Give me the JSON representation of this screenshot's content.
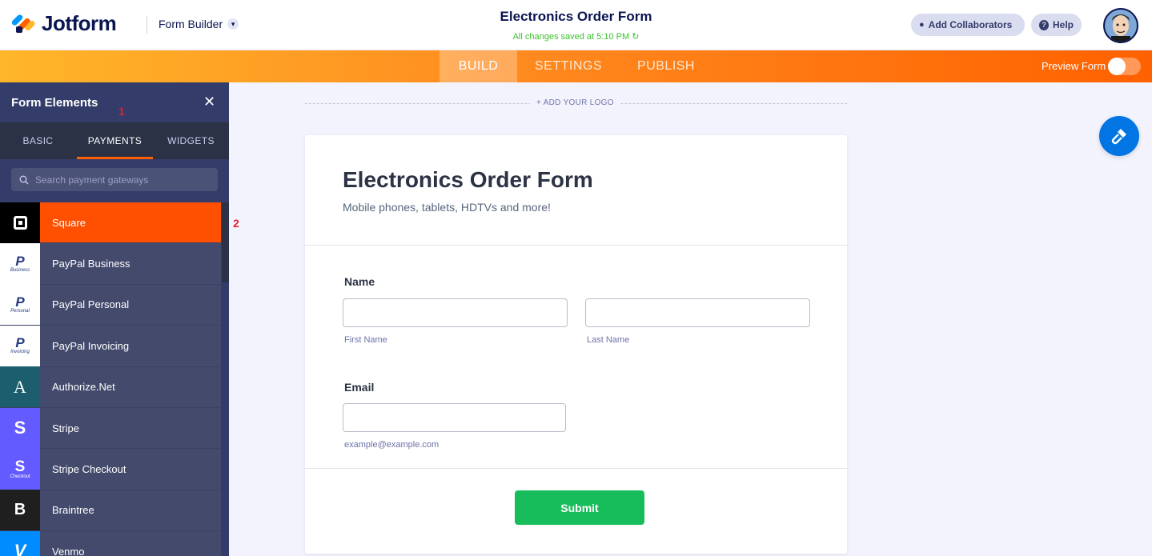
{
  "header": {
    "brand": "Jotform",
    "builder_label": "Form Builder",
    "form_title": "Electronics Order Form",
    "saved_status": "All changes saved at 5:10 PM",
    "add_collaborators_label": "Add Collaborators",
    "help_label": "Help"
  },
  "nav": {
    "tabs": [
      {
        "label": "BUILD",
        "active": true
      },
      {
        "label": "SETTINGS",
        "active": false
      },
      {
        "label": "PUBLISH",
        "active": false
      }
    ],
    "preview_label": "Preview Form",
    "preview_on": false
  },
  "sidebar": {
    "title": "Form Elements",
    "tabs": [
      {
        "label": "BASIC",
        "active": false
      },
      {
        "label": "PAYMENTS",
        "active": true
      },
      {
        "label": "WIDGETS",
        "active": false
      }
    ],
    "search_placeholder": "Search payment gateways",
    "items": [
      {
        "label": "Square",
        "icon": "square-icon",
        "icon_bg": "#000000",
        "active": true
      },
      {
        "label": "PayPal Business",
        "icon": "paypal-icon",
        "icon_caption": "Business",
        "icon_bg": "#ffffff"
      },
      {
        "label": "PayPal Personal",
        "icon": "paypal-icon",
        "icon_caption": "Personal",
        "icon_bg": "#ffffff"
      },
      {
        "label": "PayPal Invoicing",
        "icon": "paypal-icon",
        "icon_caption": "Invoicing",
        "icon_bg": "#ffffff"
      },
      {
        "label": "Authorize.Net",
        "icon": "authorize-net-icon",
        "icon_glyph": "A",
        "icon_bg": "#1c5d6e"
      },
      {
        "label": "Stripe",
        "icon": "stripe-icon",
        "icon_glyph": "S",
        "icon_bg": "#635bff"
      },
      {
        "label": "Stripe Checkout",
        "icon": "stripe-checkout-icon",
        "icon_glyph": "S",
        "icon_caption": "Checkout",
        "icon_bg": "#635bff"
      },
      {
        "label": "Braintree",
        "icon": "braintree-icon",
        "icon_glyph": "B",
        "icon_bg": "#1f1f1f"
      },
      {
        "label": "Venmo",
        "icon": "venmo-icon",
        "icon_glyph": "V",
        "icon_bg": "#008cff"
      }
    ]
  },
  "annotations": [
    "1",
    "2"
  ],
  "canvas": {
    "add_logo_label": "+ ADD YOUR LOGO",
    "form": {
      "title": "Electronics Order Form",
      "subtitle": "Mobile phones, tablets, HDTVs and more!",
      "name_label": "Name",
      "first_name_hint": "First Name",
      "last_name_hint": "Last Name",
      "email_label": "Email",
      "email_hint": "example@example.com",
      "submit_label": "Submit"
    }
  },
  "colors": {
    "brand_navy": "#0a1551",
    "accent_orange": "#ff6100",
    "sidebar_bg": "#343c6a",
    "submit_green": "#18bd5b",
    "saved_green": "#3cc22e"
  }
}
